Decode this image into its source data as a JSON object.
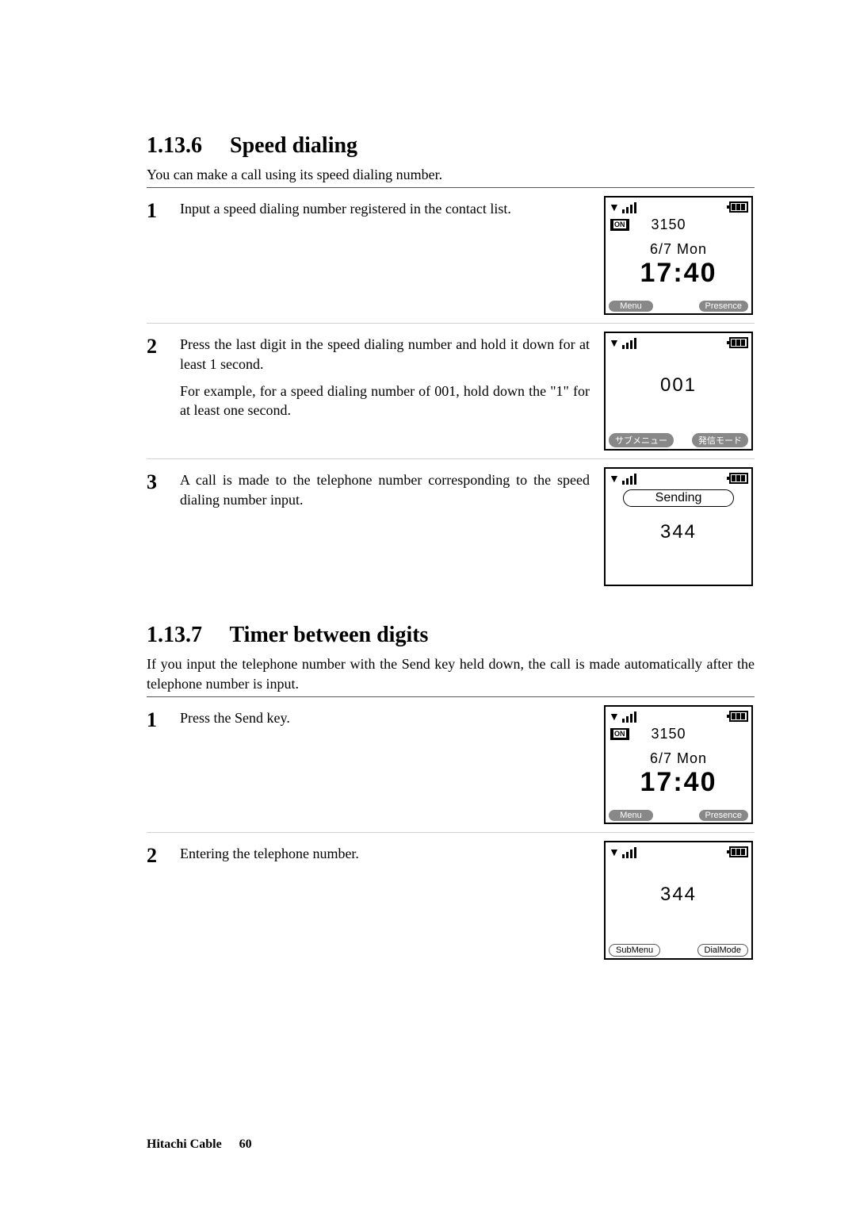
{
  "sections": [
    {
      "number": "1.13.6",
      "title": "Speed dialing",
      "intro": "You can make a call using its speed dialing number.",
      "steps": [
        {
          "num": "1",
          "paras": [
            "Input a speed dialing number registered in the contact list."
          ],
          "screen": {
            "type": "home",
            "ext": "3150",
            "date": "6/7 Mon",
            "time": "17:40",
            "left_softkey": "Menu",
            "right_softkey": "Presence"
          }
        },
        {
          "num": "2",
          "paras": [
            "Press the last digit in the speed dialing number and hold it down for at least 1 second.",
            "For example, for a speed dialing number of 001, hold down the \"1\" for at least one second."
          ],
          "screen": {
            "type": "dialing",
            "center": "001",
            "left_softkey": "サブメニュー",
            "right_softkey": "発信モード"
          }
        },
        {
          "num": "3",
          "paras": [
            "A call is made to the telephone number corresponding to the speed dialing number input."
          ],
          "screen": {
            "type": "sending",
            "bubble": "Sending",
            "number": "344"
          }
        }
      ]
    },
    {
      "number": "1.13.7",
      "title": "Timer between digits",
      "intro": "If you input the telephone number with the Send key held down, the call is made automatically after the telephone number is input.",
      "steps": [
        {
          "num": "1",
          "paras": [
            "Press the Send key."
          ],
          "screen": {
            "type": "home",
            "ext": "3150",
            "date": "6/7 Mon",
            "time": "17:40",
            "left_softkey": "Menu",
            "right_softkey": "Presence"
          }
        },
        {
          "num": "2",
          "paras": [
            "Entering the telephone number."
          ],
          "screen": {
            "type": "dialing2",
            "center": "344",
            "left_softkey": "SubMenu",
            "right_softkey": "DialMode"
          }
        }
      ]
    }
  ],
  "footer": {
    "publisher": "Hitachi Cable",
    "page": "60"
  }
}
